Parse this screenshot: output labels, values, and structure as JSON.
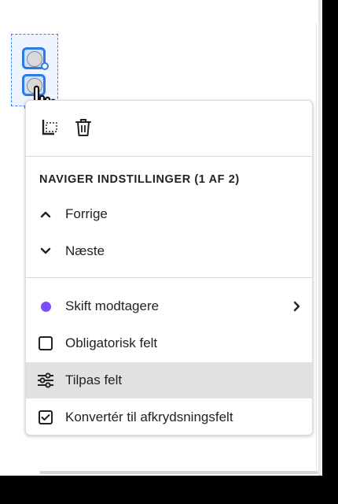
{
  "colors": {
    "accent": "#2c7be5",
    "recipient_dot": "#7b4dff",
    "highlight": "#e1e1e1"
  },
  "field": {
    "type": "radio-group",
    "icons": [
      "radio-button-icon",
      "radio-button-icon"
    ]
  },
  "menu": {
    "actions": [
      {
        "icon": "duplicate-icon"
      },
      {
        "icon": "trash-icon"
      }
    ],
    "section_title": "NAVIGER INDSTILLINGER (1 AF 2)",
    "navigation": [
      {
        "label": "Forrige",
        "icon": "chevron-up-icon"
      },
      {
        "label": "Næste",
        "icon": "chevron-down-icon"
      }
    ],
    "items": [
      {
        "label": "Skift modtagere",
        "icon": "recipient-dot-icon",
        "has_submenu": true
      },
      {
        "label": "Obligatorisk felt",
        "icon": "checkbox-unchecked-icon"
      },
      {
        "label": "Tilpas felt",
        "icon": "sliders-icon",
        "highlighted": true
      },
      {
        "label": "Konvertér til afkrydsningsfelt",
        "icon": "checkbox-checked-icon"
      }
    ]
  }
}
